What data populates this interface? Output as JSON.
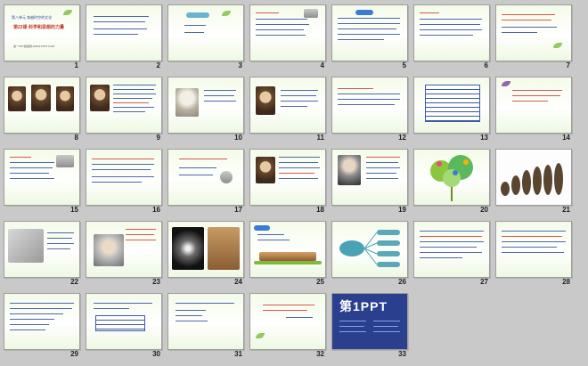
{
  "slides": [
    {
      "number": "1",
      "kind": "title",
      "subtitle": "第八单元 穿越时空的文化",
      "title": "第22课 科学和思想的力量",
      "footer": "第一PPT模板网-WWW.1PPT.COM"
    },
    {
      "number": "2",
      "kind": "text"
    },
    {
      "number": "3",
      "kind": "text"
    },
    {
      "number": "4",
      "kind": "text"
    },
    {
      "number": "5",
      "kind": "text"
    },
    {
      "number": "6",
      "kind": "text"
    },
    {
      "number": "7",
      "kind": "text"
    },
    {
      "number": "8",
      "kind": "portraits"
    },
    {
      "number": "9",
      "kind": "portrait-text"
    },
    {
      "number": "10",
      "kind": "bust-text"
    },
    {
      "number": "11",
      "kind": "portrait-text"
    },
    {
      "number": "12",
      "kind": "text"
    },
    {
      "number": "13",
      "kind": "table"
    },
    {
      "number": "14",
      "kind": "text"
    },
    {
      "number": "15",
      "kind": "text"
    },
    {
      "number": "16",
      "kind": "text"
    },
    {
      "number": "17",
      "kind": "text"
    },
    {
      "number": "18",
      "kind": "portrait-text"
    },
    {
      "number": "19",
      "kind": "portrait-text"
    },
    {
      "number": "20",
      "kind": "tree"
    },
    {
      "number": "21",
      "kind": "evolution"
    },
    {
      "number": "22",
      "kind": "sketch-text"
    },
    {
      "number": "23",
      "kind": "einstein"
    },
    {
      "number": "24",
      "kind": "galaxy"
    },
    {
      "number": "25",
      "kind": "building"
    },
    {
      "number": "26",
      "kind": "diagram"
    },
    {
      "number": "27",
      "kind": "text"
    },
    {
      "number": "28",
      "kind": "text"
    },
    {
      "number": "29",
      "kind": "text"
    },
    {
      "number": "30",
      "kind": "text"
    },
    {
      "number": "31",
      "kind": "text"
    },
    {
      "number": "32",
      "kind": "quote"
    },
    {
      "number": "33",
      "kind": "logo",
      "logo": "第1PPT"
    }
  ]
}
